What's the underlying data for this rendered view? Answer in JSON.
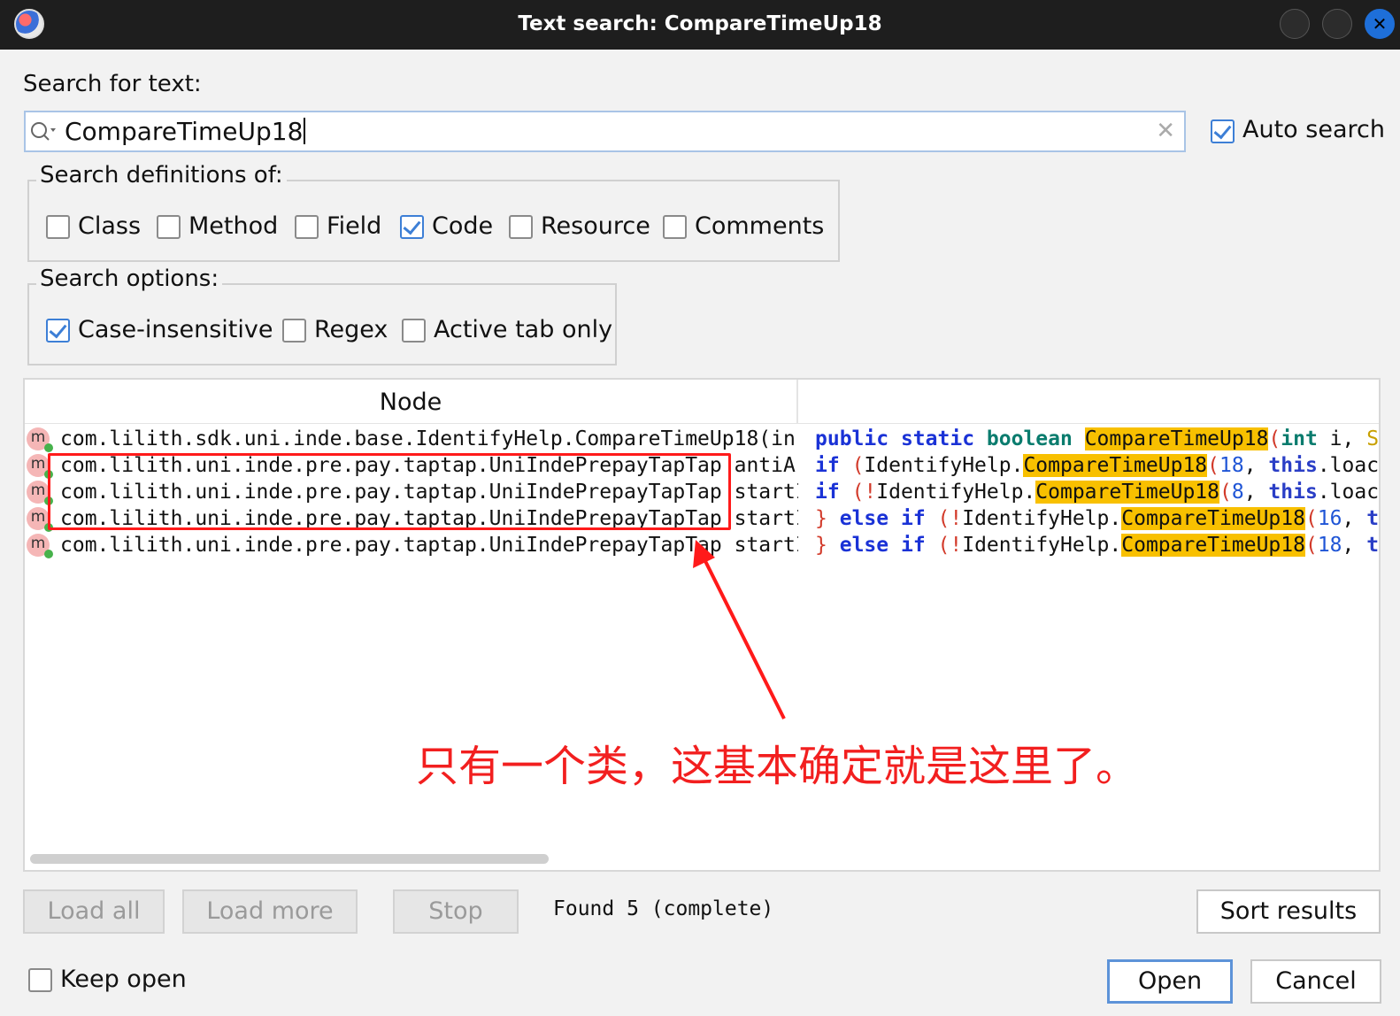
{
  "window": {
    "title": "Text search: CompareTimeUp18"
  },
  "search": {
    "label": "Search for text:",
    "value": "CompareTimeUp18",
    "auto_search_label": "Auto search",
    "auto_search_checked": true
  },
  "definitions": {
    "title": "Search definitions of:",
    "options": [
      {
        "label": "Class",
        "checked": false
      },
      {
        "label": "Method",
        "checked": false
      },
      {
        "label": "Field",
        "checked": false
      },
      {
        "label": "Code",
        "checked": true
      },
      {
        "label": "Resource",
        "checked": false
      },
      {
        "label": "Comments",
        "checked": false
      }
    ]
  },
  "search_options": {
    "title": "Search options:",
    "options": [
      {
        "label": "Case-insensitive",
        "checked": true
      },
      {
        "label": "Regex",
        "checked": false
      },
      {
        "label": "Active tab only",
        "checked": false
      }
    ]
  },
  "results": {
    "columns": [
      "Node",
      ""
    ],
    "rows": [
      {
        "icon": "m",
        "node": "com.lilith.sdk.uni.inde.base.IdentifyHelp.CompareTimeUp18(in",
        "code": "public static boolean CompareTimeUp18(int i, S"
      },
      {
        "icon": "m",
        "node": "com.lilith.uni.inde.pre.pay.taptap.UniIndePrepayTapTap antiA",
        "code": "if (IdentifyHelp.CompareTimeUp18(18, this.loac"
      },
      {
        "icon": "m",
        "node": "com.lilith.uni.inde.pre.pay.taptap.UniIndePrepayTapTap startI",
        "code": "if (!IdentifyHelp.CompareTimeUp18(8, this.loac"
      },
      {
        "icon": "m",
        "node": "com.lilith.uni.inde.pre.pay.taptap.UniIndePrepayTapTap startI",
        "code": "} else if (!IdentifyHelp.CompareTimeUp18(16, t"
      },
      {
        "icon": "m",
        "node": "com.lilith.uni.inde.pre.pay.taptap.UniIndePrepayTapTap startI",
        "code": "} else if (!IdentifyHelp.CompareTimeUp18(18, t"
      }
    ]
  },
  "annotation": {
    "text": "只有一个类，这基本确定就是这里了。",
    "color": "#f21f1f"
  },
  "buttons": {
    "load_all": "Load all",
    "load_more": "Load more",
    "stop": "Stop",
    "sort_results": "Sort results",
    "open": "Open",
    "cancel": "Cancel"
  },
  "status": "Found 5 (complete)",
  "keep_open": {
    "label": "Keep open",
    "checked": false
  },
  "colors": {
    "accent": "#3d7fd6",
    "highlight": "#f8c000",
    "keyword": "#1a32d6"
  }
}
